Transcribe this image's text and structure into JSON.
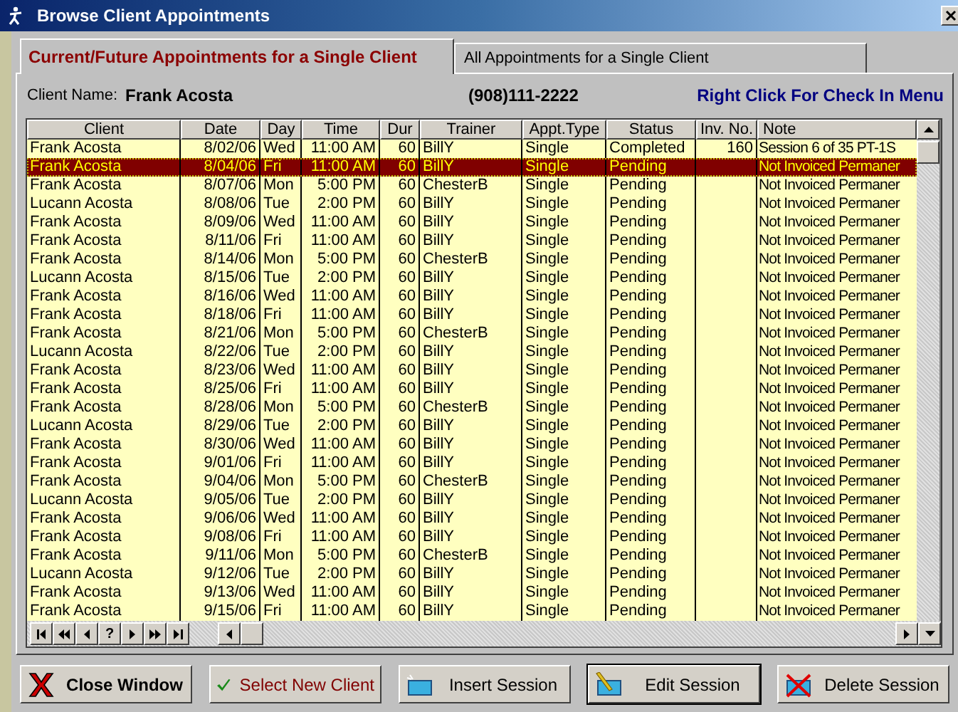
{
  "window": {
    "title": "Browse Client Appointments"
  },
  "tabs": [
    {
      "label": "Current/Future  Appointments for a Single Client",
      "selected": true
    },
    {
      "label": "All Appointments for a Single Client",
      "selected": false
    }
  ],
  "client": {
    "label": "Client Name:",
    "name": "Frank Acosta",
    "phone": "(908)111-2222",
    "hint": "Right Click For Check In Menu"
  },
  "table": {
    "columns": [
      "Client",
      "Date",
      "Day",
      "Time",
      "Dur",
      "Trainer",
      "Appt.Type",
      "Status",
      "Inv. No.",
      "Note"
    ],
    "rows": [
      {
        "client": "Frank Acosta",
        "date": "8/02/06",
        "day": "Wed",
        "time": "11:00 AM",
        "dur": "60",
        "trainer": "BillY",
        "type": "Single",
        "status": "Completed",
        "inv": "160",
        "note": "Session 6 of 35 PT-1S",
        "selected": false
      },
      {
        "client": "Frank Acosta",
        "date": "8/04/06",
        "day": "Fri",
        "time": "11:00 AM",
        "dur": "60",
        "trainer": "BillY",
        "type": "Single",
        "status": "Pending",
        "note": "Not Invoiced Permaner",
        "selected": true
      },
      {
        "client": "Frank Acosta",
        "date": "8/07/06",
        "day": "Mon",
        "time": "5:00 PM",
        "dur": "60",
        "trainer": "ChesterB",
        "type": "Single",
        "status": "Pending",
        "note": "Not Invoiced Permaner",
        "selected": false
      },
      {
        "client": "Lucann Acosta",
        "date": "8/08/06",
        "day": "Tue",
        "time": "2:00 PM",
        "dur": "60",
        "trainer": "BillY",
        "type": "Single",
        "status": "Pending",
        "note": "Not Invoiced Permaner",
        "selected": false
      },
      {
        "client": "Frank Acosta",
        "date": "8/09/06",
        "day": "Wed",
        "time": "11:00 AM",
        "dur": "60",
        "trainer": "BillY",
        "type": "Single",
        "status": "Pending",
        "note": "Not Invoiced Permaner",
        "selected": false
      },
      {
        "client": "Frank Acosta",
        "date": "8/11/06",
        "day": "Fri",
        "time": "11:00 AM",
        "dur": "60",
        "trainer": "BillY",
        "type": "Single",
        "status": "Pending",
        "note": "Not Invoiced Permaner",
        "selected": false
      },
      {
        "client": "Frank Acosta",
        "date": "8/14/06",
        "day": "Mon",
        "time": "5:00 PM",
        "dur": "60",
        "trainer": "ChesterB",
        "type": "Single",
        "status": "Pending",
        "note": "Not Invoiced Permaner",
        "selected": false
      },
      {
        "client": "Lucann Acosta",
        "date": "8/15/06",
        "day": "Tue",
        "time": "2:00 PM",
        "dur": "60",
        "trainer": "BillY",
        "type": "Single",
        "status": "Pending",
        "note": "Not Invoiced Permaner",
        "selected": false
      },
      {
        "client": "Frank Acosta",
        "date": "8/16/06",
        "day": "Wed",
        "time": "11:00 AM",
        "dur": "60",
        "trainer": "BillY",
        "type": "Single",
        "status": "Pending",
        "note": "Not Invoiced Permaner",
        "selected": false
      },
      {
        "client": "Frank Acosta",
        "date": "8/18/06",
        "day": "Fri",
        "time": "11:00 AM",
        "dur": "60",
        "trainer": "BillY",
        "type": "Single",
        "status": "Pending",
        "note": "Not Invoiced Permaner",
        "selected": false
      },
      {
        "client": "Frank Acosta",
        "date": "8/21/06",
        "day": "Mon",
        "time": "5:00 PM",
        "dur": "60",
        "trainer": "ChesterB",
        "type": "Single",
        "status": "Pending",
        "note": "Not Invoiced Permaner",
        "selected": false
      },
      {
        "client": "Lucann Acosta",
        "date": "8/22/06",
        "day": "Tue",
        "time": "2:00 PM",
        "dur": "60",
        "trainer": "BillY",
        "type": "Single",
        "status": "Pending",
        "note": "Not Invoiced Permaner",
        "selected": false
      },
      {
        "client": "Frank Acosta",
        "date": "8/23/06",
        "day": "Wed",
        "time": "11:00 AM",
        "dur": "60",
        "trainer": "BillY",
        "type": "Single",
        "status": "Pending",
        "note": "Not Invoiced Permaner",
        "selected": false
      },
      {
        "client": "Frank Acosta",
        "date": "8/25/06",
        "day": "Fri",
        "time": "11:00 AM",
        "dur": "60",
        "trainer": "BillY",
        "type": "Single",
        "status": "Pending",
        "note": "Not Invoiced Permaner",
        "selected": false
      },
      {
        "client": "Frank Acosta",
        "date": "8/28/06",
        "day": "Mon",
        "time": "5:00 PM",
        "dur": "60",
        "trainer": "ChesterB",
        "type": "Single",
        "status": "Pending",
        "note": "Not Invoiced Permaner",
        "selected": false
      },
      {
        "client": "Lucann Acosta",
        "date": "8/29/06",
        "day": "Tue",
        "time": "2:00 PM",
        "dur": "60",
        "trainer": "BillY",
        "type": "Single",
        "status": "Pending",
        "note": "Not Invoiced Permaner",
        "selected": false
      },
      {
        "client": "Frank Acosta",
        "date": "8/30/06",
        "day": "Wed",
        "time": "11:00 AM",
        "dur": "60",
        "trainer": "BillY",
        "type": "Single",
        "status": "Pending",
        "note": "Not Invoiced Permaner",
        "selected": false
      },
      {
        "client": "Frank Acosta",
        "date": "9/01/06",
        "day": "Fri",
        "time": "11:00 AM",
        "dur": "60",
        "trainer": "BillY",
        "type": "Single",
        "status": "Pending",
        "note": "Not Invoiced Permaner",
        "selected": false
      },
      {
        "client": "Frank Acosta",
        "date": "9/04/06",
        "day": "Mon",
        "time": "5:00 PM",
        "dur": "60",
        "trainer": "ChesterB",
        "type": "Single",
        "status": "Pending",
        "note": "Not Invoiced Permaner",
        "selected": false
      },
      {
        "client": "Lucann Acosta",
        "date": "9/05/06",
        "day": "Tue",
        "time": "2:00 PM",
        "dur": "60",
        "trainer": "BillY",
        "type": "Single",
        "status": "Pending",
        "note": "Not Invoiced Permaner",
        "selected": false
      },
      {
        "client": "Frank Acosta",
        "date": "9/06/06",
        "day": "Wed",
        "time": "11:00 AM",
        "dur": "60",
        "trainer": "BillY",
        "type": "Single",
        "status": "Pending",
        "note": "Not Invoiced Permaner",
        "selected": false
      },
      {
        "client": "Frank Acosta",
        "date": "9/08/06",
        "day": "Fri",
        "time": "11:00 AM",
        "dur": "60",
        "trainer": "BillY",
        "type": "Single",
        "status": "Pending",
        "note": "Not Invoiced Permaner",
        "selected": false
      },
      {
        "client": "Frank Acosta",
        "date": "9/11/06",
        "day": "Mon",
        "time": "5:00 PM",
        "dur": "60",
        "trainer": "ChesterB",
        "type": "Single",
        "status": "Pending",
        "note": "Not Invoiced Permaner",
        "selected": false
      },
      {
        "client": "Lucann Acosta",
        "date": "9/12/06",
        "day": "Tue",
        "time": "2:00 PM",
        "dur": "60",
        "trainer": "BillY",
        "type": "Single",
        "status": "Pending",
        "note": "Not Invoiced Permaner",
        "selected": false
      },
      {
        "client": "Frank Acosta",
        "date": "9/13/06",
        "day": "Wed",
        "time": "11:00 AM",
        "dur": "60",
        "trainer": "BillY",
        "type": "Single",
        "status": "Pending",
        "note": "Not Invoiced Permaner",
        "selected": false
      },
      {
        "client": "Frank Acosta",
        "date": "9/15/06",
        "day": "Fri",
        "time": "11:00 AM",
        "dur": "60",
        "trainer": "BillY",
        "type": "Single",
        "status": "Pending",
        "note": "Not Invoiced Permaner",
        "selected": false
      }
    ]
  },
  "navigator": [
    {
      "kind": "first"
    },
    {
      "kind": "prev-page"
    },
    {
      "kind": "prev"
    },
    {
      "kind": "help",
      "label": "?"
    },
    {
      "kind": "next"
    },
    {
      "kind": "next-page"
    },
    {
      "kind": "last"
    }
  ],
  "buttons": [
    {
      "kind": "close",
      "label": "Close Window",
      "focused": false
    },
    {
      "kind": "select",
      "label": "Select New Client",
      "focused": false
    },
    {
      "kind": "insert",
      "label": "Insert Session",
      "focused": false
    },
    {
      "kind": "edit",
      "label": "Edit Session",
      "focused": true
    },
    {
      "kind": "delete",
      "label": "Delete Session",
      "focused": false
    }
  ]
}
